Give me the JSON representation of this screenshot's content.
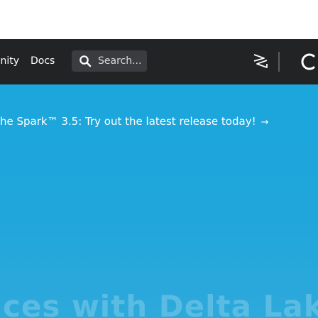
{
  "navbar": {
    "community_label": "Community",
    "docs_label": "Docs",
    "search": {
      "placeholder": "Search...",
      "icon": "search-icon"
    },
    "icons": [
      "stack-icon",
      "theme-toggle-icon"
    ]
  },
  "hero": {
    "announcement": "he Spark™ 3.5: Try out the latest release today!",
    "announcement_arrow": "→",
    "title": "ces with Delta Lake"
  },
  "colors": {
    "navbar_bg": "#222325",
    "search_bg": "#3a3c3f",
    "hero_bg": "#1ba6dc",
    "text": "#ffffff"
  }
}
